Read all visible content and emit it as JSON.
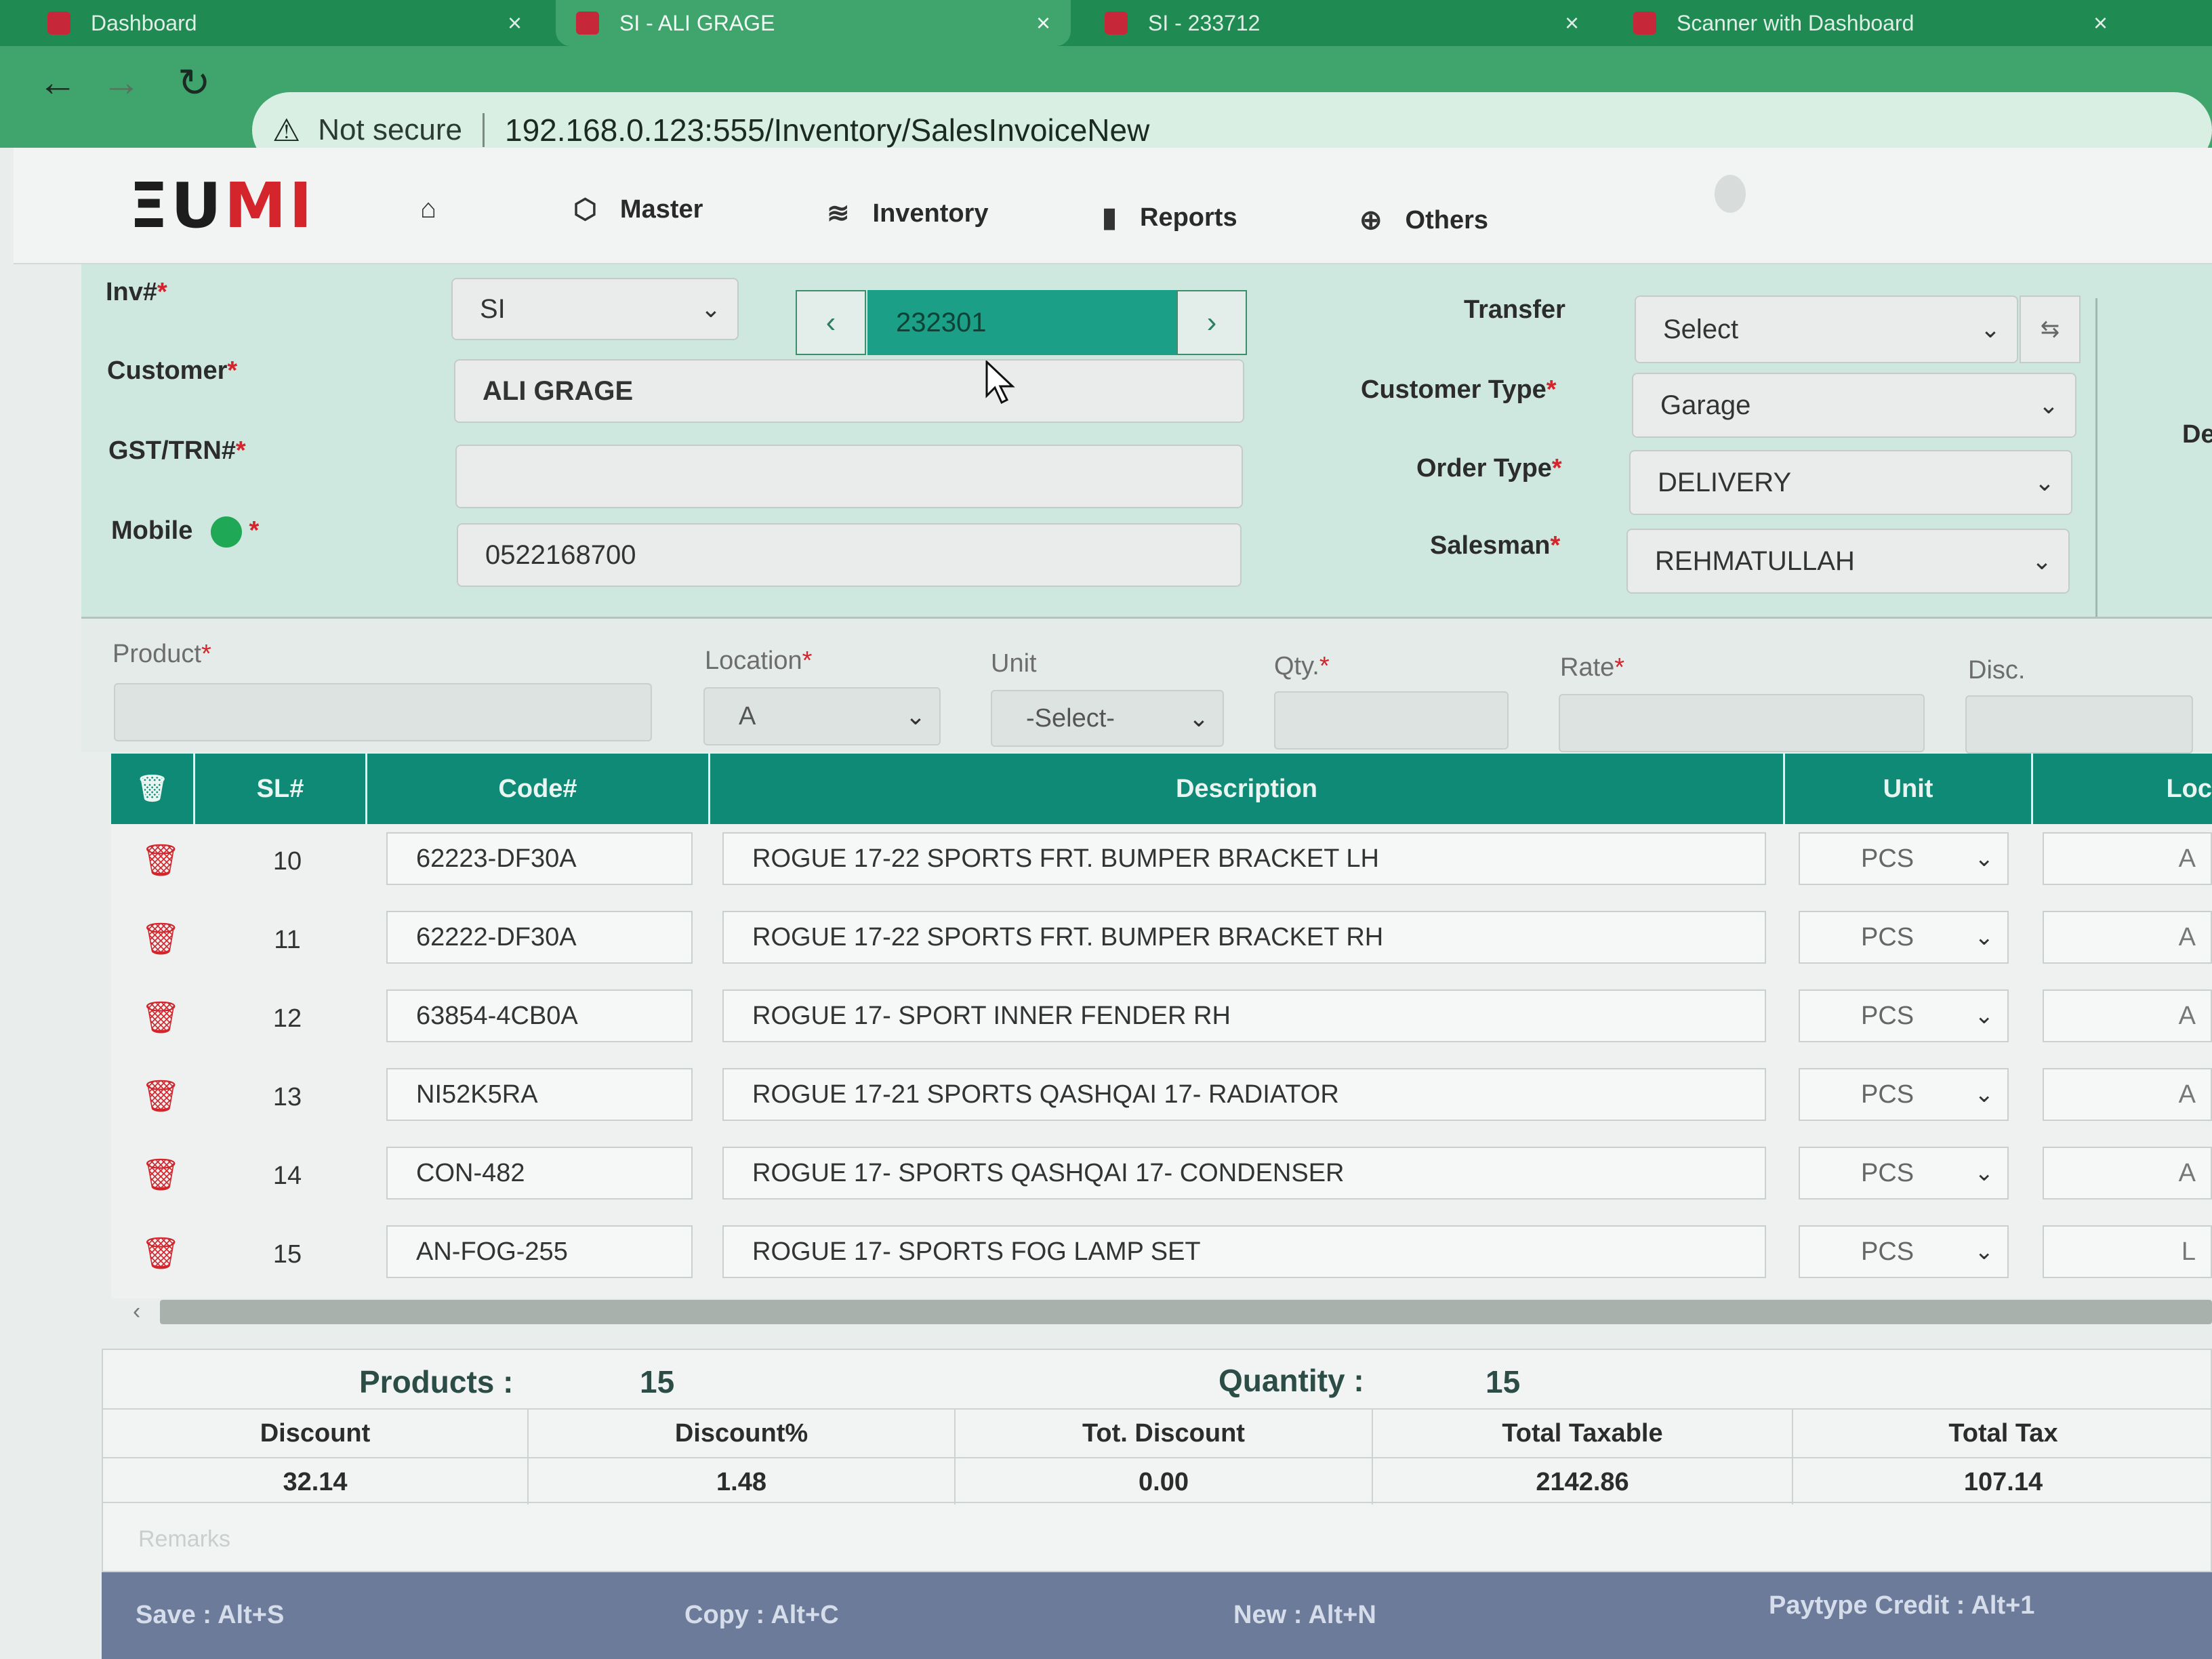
{
  "browser": {
    "tabs": [
      {
        "title": "Dashboard",
        "active": false
      },
      {
        "title": "SI - ALI GRAGE",
        "active": true
      },
      {
        "title": "SI - 233712",
        "active": false
      },
      {
        "title": "Scanner with Dashboard",
        "active": false
      }
    ],
    "security_label": "Not secure",
    "url": "192.168.0.123:555/Inventory/SalesInvoiceNew"
  },
  "app": {
    "logo": "EUMI",
    "menu": [
      {
        "label": "Master",
        "icon": "cube-icon"
      },
      {
        "label": "Inventory",
        "icon": "layers-icon"
      },
      {
        "label": "Reports",
        "icon": "bar-chart-icon"
      },
      {
        "label": "Others",
        "icon": "globe-icon"
      }
    ]
  },
  "form": {
    "inv_label": "Inv#",
    "inv_prefix": "SI",
    "inv_number": "232301",
    "customer_label": "Customer",
    "customer_value": "ALI GRAGE",
    "gst_label": "GST/TRN#",
    "gst_value": "",
    "mobile_label": "Mobile",
    "mobile_value": "0522168700",
    "transfer_label": "Transfer",
    "transfer_value": "Select",
    "customer_type_label": "Customer Type",
    "customer_type_value": "Garage",
    "order_type_label": "Order Type",
    "order_type_value": "DELIVERY",
    "salesman_label": "Salesman",
    "salesman_value": "REHMATULLAH",
    "right_partial_label": "De"
  },
  "entry": {
    "product_label": "Product",
    "location_label": "Location",
    "location_value": "A",
    "unit_label": "Unit",
    "unit_value": "-Select-",
    "qty_label": "Qty.",
    "rate_label": "Rate",
    "disc_label": "Disc."
  },
  "table": {
    "headers": {
      "sl": "SL#",
      "code": "Code#",
      "description": "Description",
      "unit": "Unit",
      "loc": "Loc"
    },
    "rows": [
      {
        "sl": "10",
        "code": "62223-DF30A",
        "description": "ROGUE 17-22 SPORTS FRT. BUMPER BRACKET LH",
        "unit": "PCS",
        "loc": "A"
      },
      {
        "sl": "11",
        "code": "62222-DF30A",
        "description": "ROGUE 17-22 SPORTS FRT. BUMPER BRACKET RH",
        "unit": "PCS",
        "loc": "A"
      },
      {
        "sl": "12",
        "code": "63854-4CB0A",
        "description": "ROGUE 17- SPORT INNER FENDER RH",
        "unit": "PCS",
        "loc": "A"
      },
      {
        "sl": "13",
        "code": "NI52K5RA",
        "description": "ROGUE 17-21 SPORTS QASHQAI 17- RADIATOR",
        "unit": "PCS",
        "loc": "A"
      },
      {
        "sl": "14",
        "code": "CON-482",
        "description": "ROGUE 17- SPORTS QASHQAI 17- CONDENSER",
        "unit": "PCS",
        "loc": "A"
      },
      {
        "sl": "15",
        "code": "AN-FOG-255",
        "description": "ROGUE 17- SPORTS FOG LAMP SET",
        "unit": "PCS",
        "loc": "L"
      }
    ]
  },
  "summary": {
    "products_label": "Products :",
    "products_value": "15",
    "quantity_label": "Quantity :",
    "quantity_value": "15",
    "columns": [
      {
        "label": "Discount",
        "value": "32.14"
      },
      {
        "label": "Discount%",
        "value": "1.48"
      },
      {
        "label": "Tot. Discount",
        "value": "0.00"
      },
      {
        "label": "Total Taxable",
        "value": "2142.86"
      },
      {
        "label": "Total Tax",
        "value": "107.14"
      }
    ],
    "remarks_label": "Remarks"
  },
  "shortcuts": [
    {
      "label": "Save : Alt+S"
    },
    {
      "label": "Copy : Alt+C"
    },
    {
      "label": "New : Alt+N"
    },
    {
      "label": "Paytype Credit : Alt+1"
    }
  ]
}
